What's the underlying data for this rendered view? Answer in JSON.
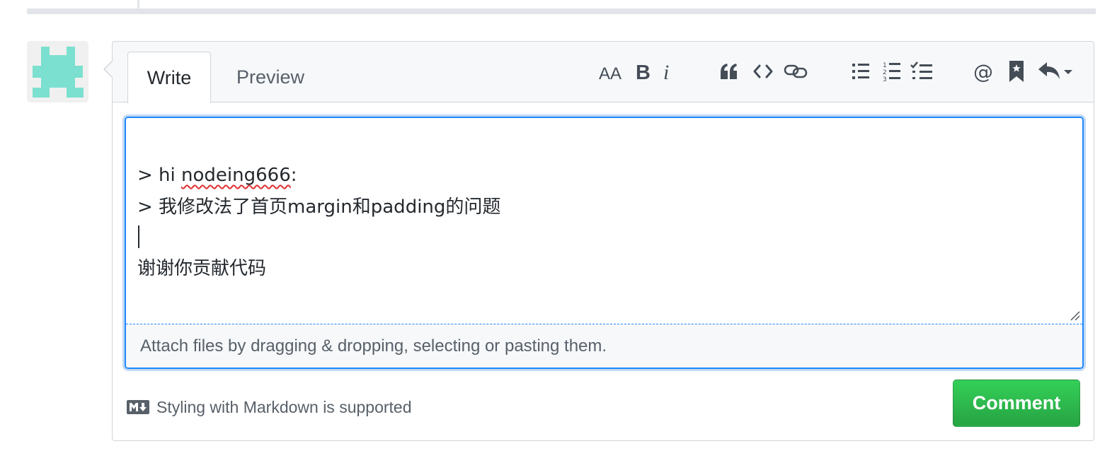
{
  "tabs": {
    "write": "Write",
    "preview": "Preview"
  },
  "toolbar": {
    "heading_label": "AA",
    "bold_label": "B",
    "italic_label": "i",
    "quote_label": "“",
    "code_label": "<>",
    "mention_label": "@"
  },
  "editor": {
    "line_quote_author_prefix": "> hi ",
    "line_quote_author_name": "nodeing666",
    "line_quote_author_suffix": ":",
    "line_quote_body": "> 我修改法了首页margin和padding的问题",
    "line_reply": "谢谢你贡献代码",
    "attach_hint": "Attach files by dragging & dropping, selecting or pasting them."
  },
  "footer": {
    "markdown_note": "Styling with Markdown is supported",
    "comment_button": "Comment"
  },
  "colors": {
    "accent": "#2188ff",
    "button_green": "#28a745",
    "avatar_color": "#7be0cf"
  },
  "icons": [
    "heading-icon",
    "bold-icon",
    "italic-icon",
    "quote-icon",
    "code-icon",
    "link-icon",
    "unordered-list-icon",
    "ordered-list-icon",
    "task-list-icon",
    "mention-icon",
    "saved-reply-icon",
    "reply-icon",
    "markdown-icon"
  ]
}
